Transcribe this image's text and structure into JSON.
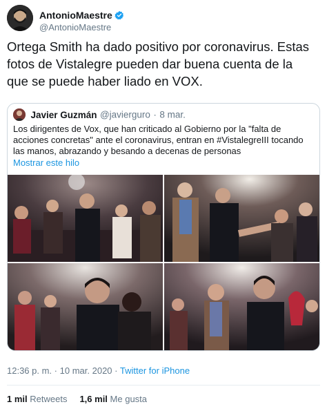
{
  "author": {
    "name": "AntonioMaestre",
    "handle": "@AntonioMaestre"
  },
  "tweet": {
    "text": "Ortega Smith ha dado positivo por coronavirus. Estas fotos de Vistalegre pueden dar buena cuenta de la que se puede haber liado en VOX."
  },
  "quoted": {
    "name": "Javier Guzmán",
    "handle": "@javierguro",
    "separator": "·",
    "date": "8 mar.",
    "text": "Los dirigentes de Vox, que han criticado al Gobierno por la \"falta de acciones concretas\" ante el coronavirus, entran en #VistalegreIII tocando las manos, abrazando y besando a decenas de personas",
    "show_thread": "Mostrar este hilo"
  },
  "meta": {
    "time": "12:36 p. m.",
    "separator": "·",
    "date": "10 mar. 2020",
    "separator2": "·",
    "source": "Twitter for iPhone"
  },
  "stats": {
    "retweets_count": "1 mil",
    "retweets_label": "Retweets",
    "likes_count": "1,6 mil",
    "likes_label": "Me gusta"
  },
  "colors": {
    "link": "#1b95e0",
    "secondary": "#657786",
    "border": "#ccd6dd",
    "verified": "#1da1f2"
  }
}
